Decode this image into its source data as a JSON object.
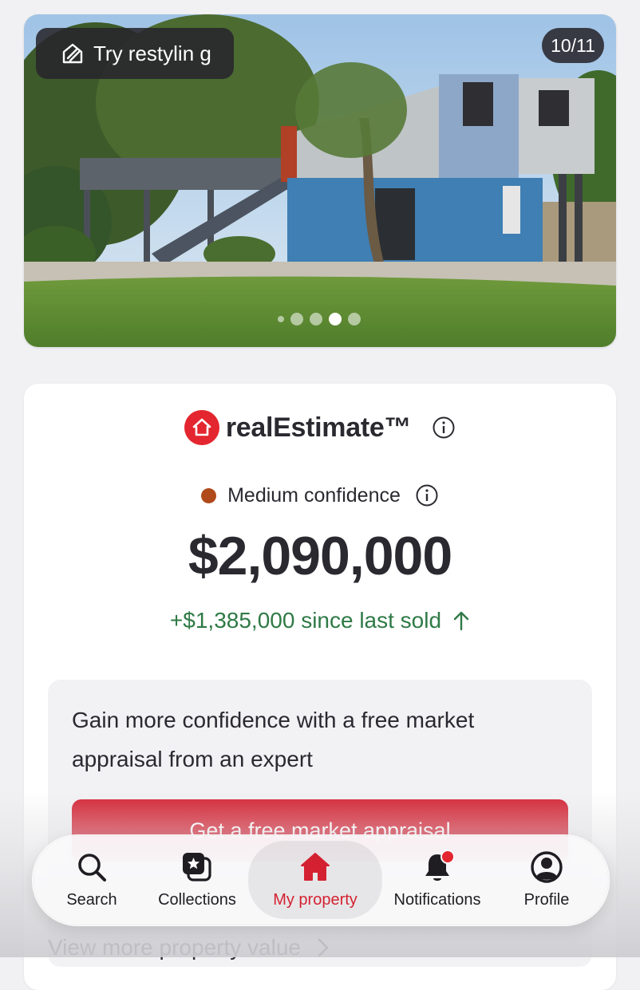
{
  "photo": {
    "restyle_label": "Try restylin g",
    "counter": "10/11"
  },
  "estimate": {
    "brand": "realEstimate™",
    "confidence": "Medium confidence",
    "confidence_color": "#b04a1a",
    "price": "$2,090,000",
    "change": "+$1,385,000 since last sold"
  },
  "appraisal": {
    "text": "Gain more confidence with a free market appraisal from an expert",
    "cta": "Get a free market appraisal"
  },
  "view_more": "View more property value",
  "nav": {
    "tabs": [
      {
        "label": "Search",
        "icon": "search-icon"
      },
      {
        "label": "Collections",
        "icon": "collections-icon"
      },
      {
        "label": "My property",
        "icon": "home-icon",
        "active": true
      },
      {
        "label": "Notifications",
        "icon": "bell-icon",
        "badge": true
      },
      {
        "label": "Profile",
        "icon": "profile-icon"
      }
    ]
  },
  "colors": {
    "brand_red": "#e3262f",
    "cta_red": "#d42131",
    "positive_green": "#2f7a46"
  }
}
